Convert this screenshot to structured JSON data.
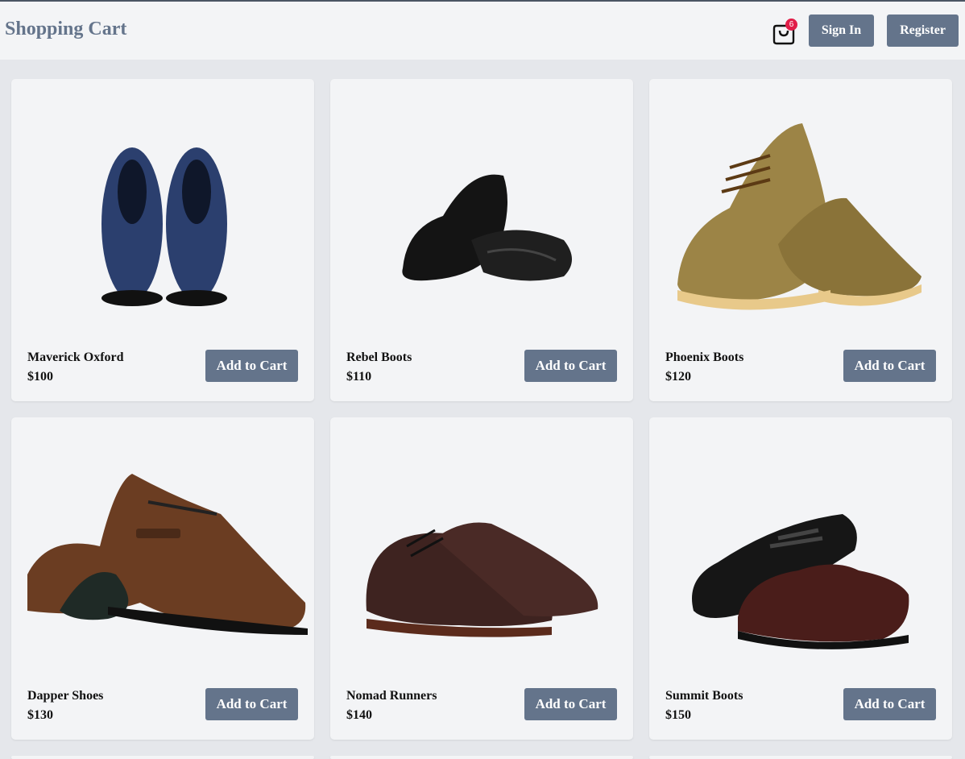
{
  "header": {
    "title": "Shopping Cart",
    "cart_count": "6",
    "signin_label": "Sign In",
    "register_label": "Register"
  },
  "products": [
    {
      "name": "Maverick Oxford",
      "price": "$100",
      "add_label": "Add to Cart",
      "color": "#2b3f6e"
    },
    {
      "name": "Rebel Boots",
      "price": "$110",
      "add_label": "Add to Cart",
      "color": "#141414"
    },
    {
      "name": "Phoenix Boots",
      "price": "$120",
      "add_label": "Add to Cart",
      "color": "#9c8446"
    },
    {
      "name": "Dapper Shoes",
      "price": "$130",
      "add_label": "Add to Cart",
      "color": "#6b3d22"
    },
    {
      "name": "Nomad Runners",
      "price": "$140",
      "add_label": "Add to Cart",
      "color": "#3e2320"
    },
    {
      "name": "Summit Boots",
      "price": "$150",
      "add_label": "Add to Cart",
      "color": "#4a1d1a"
    }
  ],
  "colors": {
    "accent": "#64748b",
    "badge": "#e11d48",
    "background": "#e5e7eb",
    "card": "#f3f4f6"
  }
}
